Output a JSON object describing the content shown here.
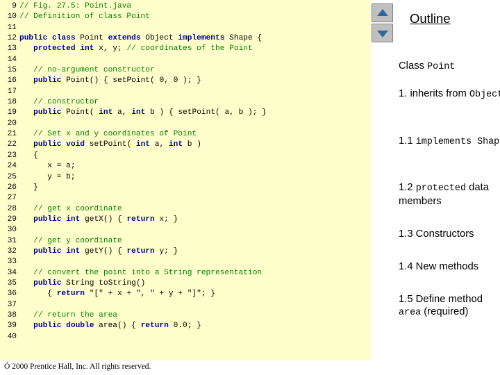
{
  "slide": {
    "footer": "Ó 2000 Prentice Hall, Inc. All rights reserved."
  },
  "code": {
    "lines": [
      {
        "n": "9",
        "parts": [
          {
            "t": "// Fig. 27.5: Point.java",
            "c": "cm"
          }
        ]
      },
      {
        "n": "10",
        "parts": [
          {
            "t": "// Definition of class Point",
            "c": "cm"
          }
        ]
      },
      {
        "n": "11",
        "parts": []
      },
      {
        "n": "12",
        "parts": [
          {
            "t": "public class",
            "c": "kw"
          },
          {
            "t": " Point ",
            "c": "pl"
          },
          {
            "t": "extends",
            "c": "kw"
          },
          {
            "t": " Object ",
            "c": "pl"
          },
          {
            "t": "implements",
            "c": "kw"
          },
          {
            "t": " Shape {",
            "c": "pl"
          }
        ]
      },
      {
        "n": "13",
        "parts": [
          {
            "t": "   ",
            "c": "pl"
          },
          {
            "t": "protected int",
            "c": "kw"
          },
          {
            "t": " x, y; ",
            "c": "pl"
          },
          {
            "t": "// coordinates of the Point",
            "c": "cm"
          }
        ]
      },
      {
        "n": "14",
        "parts": []
      },
      {
        "n": "15",
        "parts": [
          {
            "t": "   ",
            "c": "pl"
          },
          {
            "t": "// no-argument constructor",
            "c": "cm"
          }
        ]
      },
      {
        "n": "16",
        "parts": [
          {
            "t": "   ",
            "c": "pl"
          },
          {
            "t": "public",
            "c": "kw"
          },
          {
            "t": " Point() { setPoint( 0, 0 ); }",
            "c": "pl"
          }
        ]
      },
      {
        "n": "17",
        "parts": []
      },
      {
        "n": "18",
        "parts": [
          {
            "t": "   ",
            "c": "pl"
          },
          {
            "t": "// constructor",
            "c": "cm"
          }
        ]
      },
      {
        "n": "19",
        "parts": [
          {
            "t": "   ",
            "c": "pl"
          },
          {
            "t": "public",
            "c": "kw"
          },
          {
            "t": " Point( ",
            "c": "pl"
          },
          {
            "t": "int",
            "c": "kw"
          },
          {
            "t": " a, ",
            "c": "pl"
          },
          {
            "t": "int",
            "c": "kw"
          },
          {
            "t": " b ) { setPoint( a, b ); }",
            "c": "pl"
          }
        ]
      },
      {
        "n": "20",
        "parts": []
      },
      {
        "n": "21",
        "parts": [
          {
            "t": "   ",
            "c": "pl"
          },
          {
            "t": "// Set x and y coordinates of Point",
            "c": "cm"
          }
        ]
      },
      {
        "n": "22",
        "parts": [
          {
            "t": "   ",
            "c": "pl"
          },
          {
            "t": "public void",
            "c": "kw"
          },
          {
            "t": " setPoint( ",
            "c": "pl"
          },
          {
            "t": "int",
            "c": "kw"
          },
          {
            "t": " a, ",
            "c": "pl"
          },
          {
            "t": "int",
            "c": "kw"
          },
          {
            "t": " b )",
            "c": "pl"
          }
        ]
      },
      {
        "n": "23",
        "parts": [
          {
            "t": "   {",
            "c": "pl"
          }
        ]
      },
      {
        "n": "24",
        "parts": [
          {
            "t": "      x = a;",
            "c": "pl"
          }
        ]
      },
      {
        "n": "25",
        "parts": [
          {
            "t": "      y = b;",
            "c": "pl"
          }
        ]
      },
      {
        "n": "26",
        "parts": [
          {
            "t": "   }",
            "c": "pl"
          }
        ]
      },
      {
        "n": "27",
        "parts": []
      },
      {
        "n": "28",
        "parts": [
          {
            "t": "   ",
            "c": "pl"
          },
          {
            "t": "// get x coordinate",
            "c": "cm"
          }
        ]
      },
      {
        "n": "29",
        "parts": [
          {
            "t": "   ",
            "c": "pl"
          },
          {
            "t": "public int",
            "c": "kw"
          },
          {
            "t": " getX() { ",
            "c": "pl"
          },
          {
            "t": "return",
            "c": "kw"
          },
          {
            "t": " x; }",
            "c": "pl"
          }
        ]
      },
      {
        "n": "30",
        "parts": []
      },
      {
        "n": "31",
        "parts": [
          {
            "t": "   ",
            "c": "pl"
          },
          {
            "t": "// get y coordinate",
            "c": "cm"
          }
        ]
      },
      {
        "n": "32",
        "parts": [
          {
            "t": "   ",
            "c": "pl"
          },
          {
            "t": "public int",
            "c": "kw"
          },
          {
            "t": " getY() { ",
            "c": "pl"
          },
          {
            "t": "return",
            "c": "kw"
          },
          {
            "t": " y; }",
            "c": "pl"
          }
        ]
      },
      {
        "n": "33",
        "parts": []
      },
      {
        "n": "34",
        "parts": [
          {
            "t": "   ",
            "c": "pl"
          },
          {
            "t": "// convert the point into a String representation",
            "c": "cm"
          }
        ]
      },
      {
        "n": "35",
        "parts": [
          {
            "t": "   ",
            "c": "pl"
          },
          {
            "t": "public",
            "c": "kw"
          },
          {
            "t": " String toString()",
            "c": "pl"
          }
        ]
      },
      {
        "n": "36",
        "parts": [
          {
            "t": "      { ",
            "c": "pl"
          },
          {
            "t": "return",
            "c": "kw"
          },
          {
            "t": " \"[\" + x + \", \" + y + \"]\"; }",
            "c": "pl"
          }
        ]
      },
      {
        "n": "37",
        "parts": []
      },
      {
        "n": "38",
        "parts": [
          {
            "t": "   ",
            "c": "pl"
          },
          {
            "t": "// return the area",
            "c": "cm"
          }
        ]
      },
      {
        "n": "39",
        "parts": [
          {
            "t": "   ",
            "c": "pl"
          },
          {
            "t": "public double",
            "c": "kw"
          },
          {
            "t": " area() { ",
            "c": "pl"
          },
          {
            "t": "return",
            "c": "kw"
          },
          {
            "t": " 0.0; }",
            "c": "pl"
          }
        ]
      },
      {
        "n": "40",
        "parts": []
      }
    ]
  },
  "outline": {
    "title": "Outline",
    "scroll_up_icon": "triangle-up-icon",
    "scroll_down_icon": "triangle-down-icon",
    "items": [
      {
        "segments": [
          {
            "t": "Class ",
            "m": false
          },
          {
            "t": "Point",
            "m": true
          }
        ]
      },
      {
        "segments": [
          {
            "t": "1. inherits from ",
            "m": false
          },
          {
            "t": "Object",
            "m": true
          }
        ]
      },
      {
        "segments": [
          {
            "t": "1.1 ",
            "m": false
          },
          {
            "t": "implements Shape",
            "m": true
          }
        ]
      },
      {
        "segments": [
          {
            "t": "1.2 ",
            "m": false
          },
          {
            "t": "protected",
            "m": true
          },
          {
            "t": " data members",
            "m": false
          }
        ]
      },
      {
        "segments": [
          {
            "t": "1.3 Constructors",
            "m": false
          }
        ]
      },
      {
        "segments": [
          {
            "t": "1.4 New methods",
            "m": false
          }
        ]
      },
      {
        "segments": [
          {
            "t": "1.5 Define method ",
            "m": false
          },
          {
            "t": "area",
            "m": true
          },
          {
            "t": " (required)",
            "m": false
          }
        ]
      }
    ]
  },
  "colors": {
    "code_background": "#ffffcc",
    "keyword": "#000099",
    "comment": "#008000",
    "scroll_arrow": "#336699"
  }
}
